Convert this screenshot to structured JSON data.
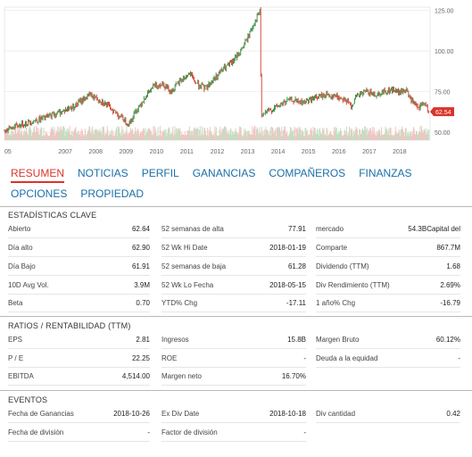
{
  "chart_data": {
    "type": "line",
    "x_ticks": [
      "05",
      "2007",
      "2008",
      "2009",
      "2010",
      "2011",
      "2012",
      "2013",
      "2014",
      "2015",
      "2016",
      "2017",
      "2018"
    ],
    "y_ticks": [
      "125.00",
      "100.00",
      "75.00",
      "50.00"
    ],
    "ylim": [
      45,
      127
    ],
    "last_price": "62.54",
    "price_points": [
      [
        2005.0,
        51
      ],
      [
        2005.6,
        55
      ],
      [
        2006.2,
        58
      ],
      [
        2006.8,
        62
      ],
      [
        2007.3,
        66
      ],
      [
        2007.8,
        73
      ],
      [
        2008.2,
        69
      ],
      [
        2008.6,
        63
      ],
      [
        2008.9,
        58
      ],
      [
        2009.1,
        55
      ],
      [
        2009.3,
        62
      ],
      [
        2009.6,
        71
      ],
      [
        2009.9,
        78
      ],
      [
        2010.2,
        80
      ],
      [
        2010.5,
        75
      ],
      [
        2010.8,
        82
      ],
      [
        2011.1,
        86
      ],
      [
        2011.3,
        80
      ],
      [
        2011.6,
        77
      ],
      [
        2011.9,
        83
      ],
      [
        2012.2,
        89
      ],
      [
        2012.5,
        93
      ],
      [
        2012.8,
        101
      ],
      [
        2013.0,
        108
      ],
      [
        2013.2,
        117
      ],
      [
        2013.4,
        124
      ],
      [
        2013.45,
        60
      ],
      [
        2013.7,
        63
      ],
      [
        2014.0,
        66
      ],
      [
        2014.4,
        70
      ],
      [
        2014.8,
        68
      ],
      [
        2015.2,
        71
      ],
      [
        2015.6,
        73
      ],
      [
        2015.9,
        72
      ],
      [
        2016.2,
        70
      ],
      [
        2016.4,
        66
      ],
      [
        2016.6,
        72
      ],
      [
        2016.9,
        75
      ],
      [
        2017.2,
        73
      ],
      [
        2017.5,
        75
      ],
      [
        2017.8,
        76
      ],
      [
        2018.0,
        74
      ],
      [
        2018.2,
        76
      ],
      [
        2018.4,
        69
      ],
      [
        2018.6,
        64
      ],
      [
        2018.8,
        68
      ],
      [
        2018.95,
        62.5
      ]
    ],
    "colors": {
      "up": "#2e8b3d",
      "down": "#d23a2a",
      "volume_up": "#bfe0bf",
      "volume_down": "#f2c4c4",
      "last_price_tag": "#d9342b",
      "grid": "#e2e2e2"
    }
  },
  "tabs": [
    {
      "label": "RESUMEN",
      "active": true
    },
    {
      "label": "NOTICIAS",
      "active": false
    },
    {
      "label": "PERFIL",
      "active": false
    },
    {
      "label": "GANANCIAS",
      "active": false
    },
    {
      "label": "COMPAÑEROS",
      "active": false
    },
    {
      "label": "FINANZAS",
      "active": false
    },
    {
      "label": "OPCIONES",
      "active": false
    },
    {
      "label": "PROPIEDAD",
      "active": false
    }
  ],
  "key_stats": {
    "title": "ESTADÍSTICAS CLAVE",
    "rows": [
      [
        {
          "label": "Abierto",
          "value": "62.64"
        },
        {
          "label": "52 semanas de alta",
          "value": "77.91"
        },
        {
          "label": "mercado",
          "value": "54.3BCapital del"
        }
      ],
      [
        {
          "label": "Día alto",
          "value": "62.90"
        },
        {
          "label": "52 Wk Hi Date",
          "value": "2018-01-19"
        },
        {
          "label": "Comparte",
          "value": "867.7M"
        }
      ],
      [
        {
          "label": "Día Bajo",
          "value": "61.91"
        },
        {
          "label": "52 semanas de baja",
          "value": "61.28"
        },
        {
          "label": "Dividendo (TTM)",
          "value": "1.68"
        }
      ],
      [
        {
          "label": "10D Avg Vol.",
          "value": "3.9M"
        },
        {
          "label": "52 Wk Lo Fecha",
          "value": "2018-05-15"
        },
        {
          "label": "Div Rendimiento (TTM)",
          "value": "2.69%"
        }
      ],
      [
        {
          "label": "Beta",
          "value": "0.70"
        },
        {
          "label": "YTD% Chg",
          "value": "-17.11"
        },
        {
          "label": "1 año% Chg",
          "value": "-16.79"
        }
      ]
    ]
  },
  "ratios": {
    "title": "RATIOS / RENTABILIDAD (TTM)",
    "rows": [
      [
        {
          "label": "EPS",
          "value": "2.81"
        },
        {
          "label": "Ingresos",
          "value": "15.8B"
        },
        {
          "label": "Margen Bruto",
          "value": "60.12%"
        }
      ],
      [
        {
          "label": "P / E",
          "value": "22.25"
        },
        {
          "label": "ROE",
          "value": "-"
        },
        {
          "label": "Deuda a la equidad",
          "value": "-"
        }
      ],
      [
        {
          "label": "EBITDA",
          "value": "4,514.00"
        },
        {
          "label": "Margen neto",
          "value": "16.70%"
        },
        {
          "label": "",
          "value": ""
        }
      ]
    ]
  },
  "events": {
    "title": "EVENTOS",
    "rows": [
      [
        {
          "label": "Fecha de Ganancias",
          "value": "2018-10-26"
        },
        {
          "label": "Ex Div Date",
          "value": "2018-10-18"
        },
        {
          "label": "Div cantidad",
          "value": "0.42"
        }
      ],
      [
        {
          "label": "Fecha de división",
          "value": "-"
        },
        {
          "label": "Factor de división",
          "value": "-"
        },
        {
          "label": "",
          "value": ""
        }
      ]
    ]
  }
}
